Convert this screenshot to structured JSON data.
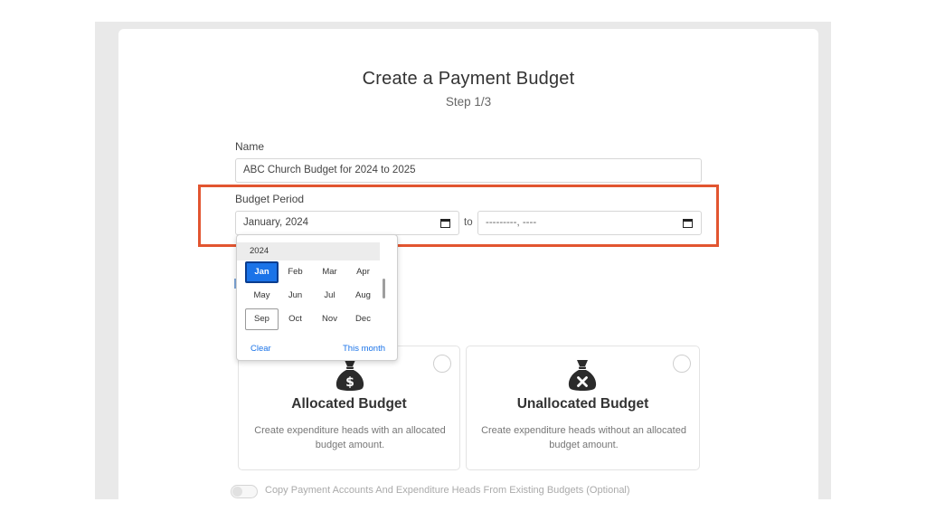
{
  "form": {
    "title": "Create a Payment Budget",
    "step": "Step 1/3",
    "name_label": "Name",
    "name_value": "ABC Church Budget for 2024 to 2025",
    "period_label": "Budget Period",
    "period_from": "January, 2024",
    "period_to_placeholder": "---------, ----",
    "period_separator": "to"
  },
  "month_picker": {
    "year": "2024",
    "months": [
      "Jan",
      "Feb",
      "Mar",
      "Apr",
      "May",
      "Jun",
      "Jul",
      "Aug",
      "Sep",
      "Oct",
      "Nov",
      "Dec"
    ],
    "selected": "Jan",
    "current": "Sep",
    "clear_label": "Clear",
    "this_month_label": "This month"
  },
  "budget_types": [
    {
      "title": "Allocated Budget",
      "description": "Create expenditure heads with an allocated budget amount.",
      "icon": "money-bag-dollar-icon"
    },
    {
      "title": "Unallocated Budget",
      "description": "Create expenditure heads without an allocated budget amount.",
      "icon": "money-bag-x-icon"
    }
  ],
  "copy_toggle": {
    "label": "Copy Payment Accounts And Expenditure Heads From Existing Budgets (Optional)",
    "enabled": false
  },
  "colors": {
    "highlight_border": "#e25530",
    "accent_blue": "#1a73e8",
    "icon_dark": "#2b2b2b"
  }
}
